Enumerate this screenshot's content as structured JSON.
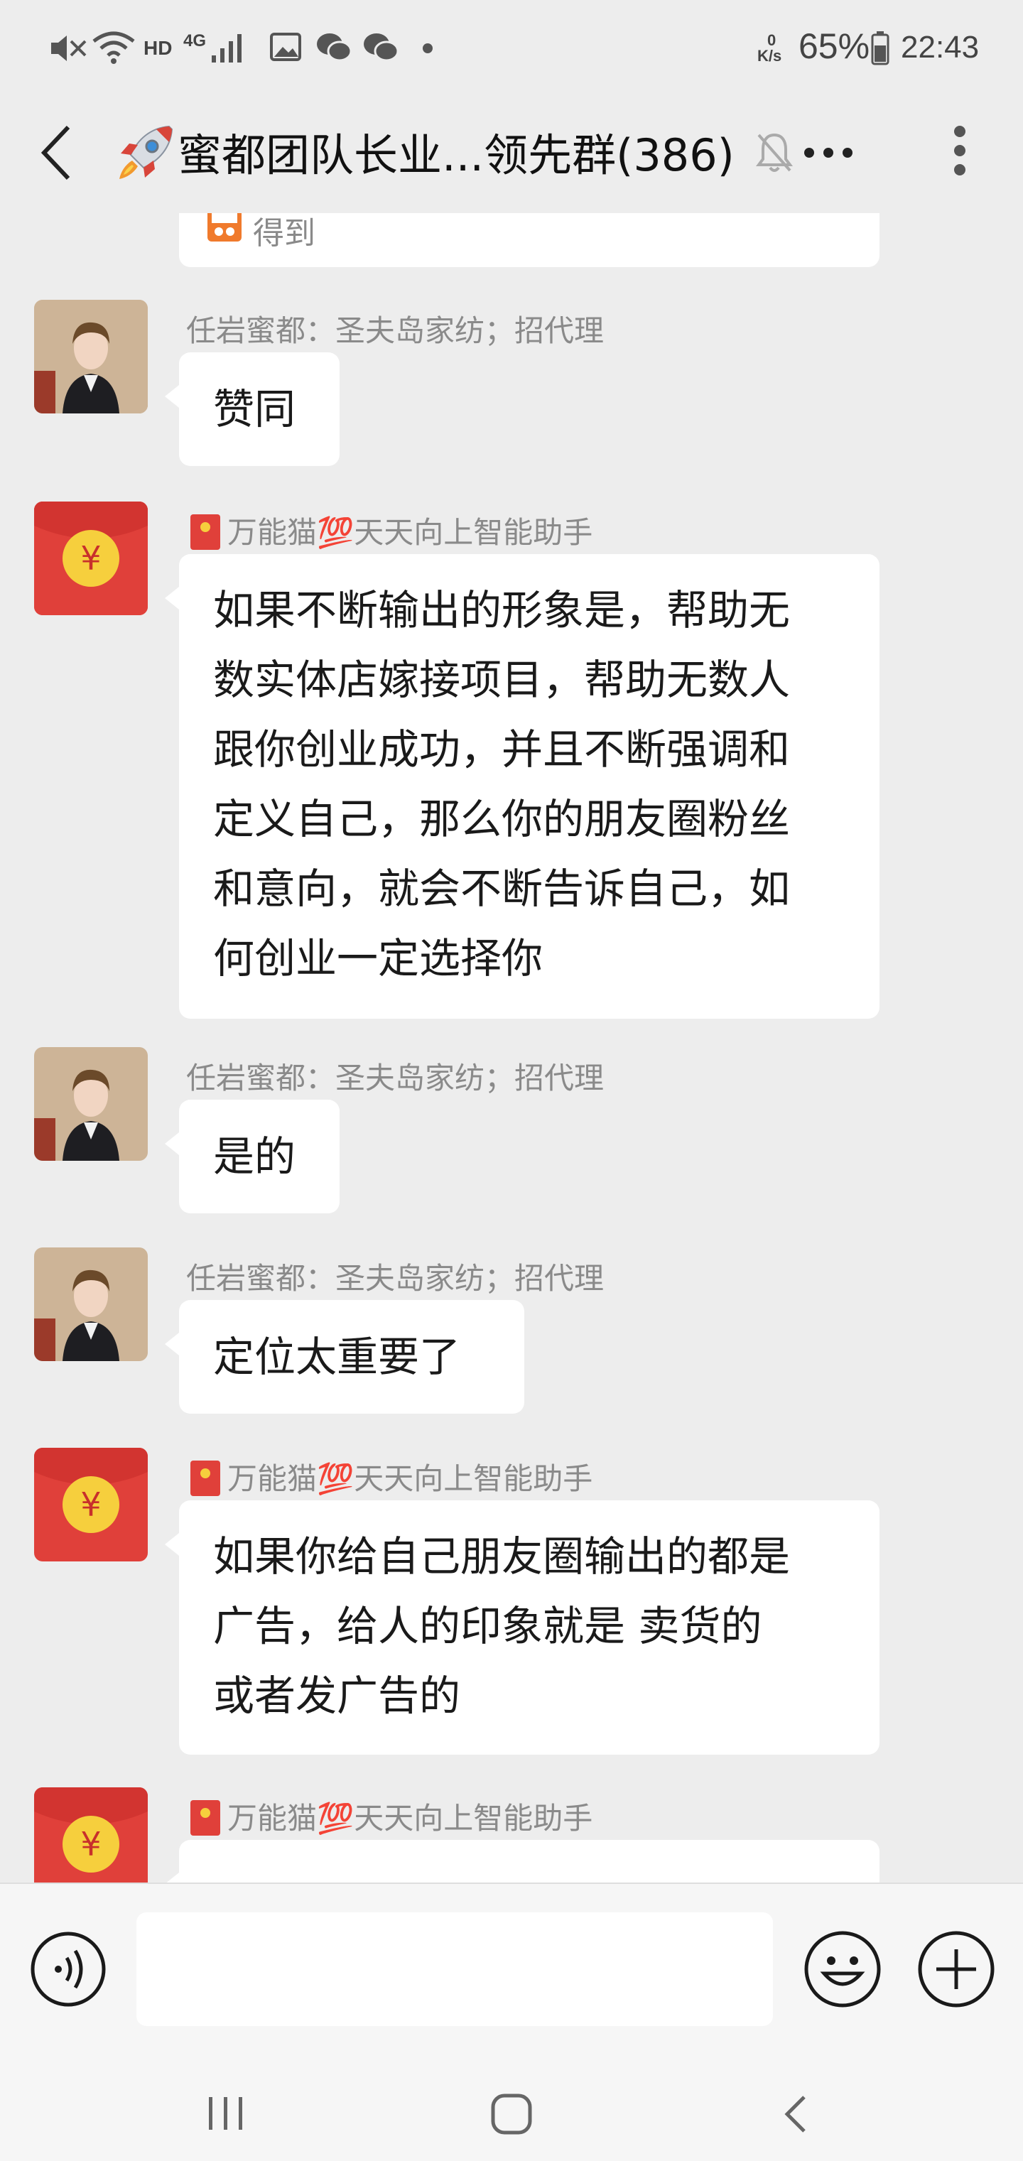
{
  "status_bar": {
    "speed_top": "0",
    "speed_unit": "K/s",
    "battery": "65%",
    "time": "22:43",
    "hd": "HD",
    "net": "4G"
  },
  "header": {
    "title": "蜜都团队长业...领先群(386)"
  },
  "messages": [
    {
      "name": "",
      "text": "得到",
      "kind": "partial-top"
    },
    {
      "name": "任岩蜜都：圣夫岛家纺；招代理",
      "lines": [
        "赞同"
      ]
    },
    {
      "name": "万能猫💯天天向上智能助手",
      "lines": [
        "如果不断输出的形象是，帮助无",
        "数实体店嫁接项目，帮助无数人",
        "跟你创业成功，并且不断强调和",
        "定义自己，那么你的朋友圈粉丝",
        "和意向，就会不断告诉自己，如",
        "何创业一定选择你"
      ]
    },
    {
      "name": "任岩蜜都：圣夫岛家纺；招代理",
      "lines": [
        "是的"
      ]
    },
    {
      "name": "任岩蜜都：圣夫岛家纺；招代理",
      "lines": [
        "定位太重要了"
      ]
    },
    {
      "name": "万能猫💯天天向上智能助手",
      "lines": [
        "如果你给自己朋友圈输出的都是",
        "广告，给人的印象就是 卖货的",
        "或者发广告的"
      ]
    },
    {
      "name": "万能猫💯天天向上智能助手",
      "lines": [
        ""
      ]
    }
  ],
  "colors": {
    "background": "#ededed",
    "bubble": "#ffffff",
    "redpacket": "#e0403a",
    "coin": "#f6cf3d"
  }
}
